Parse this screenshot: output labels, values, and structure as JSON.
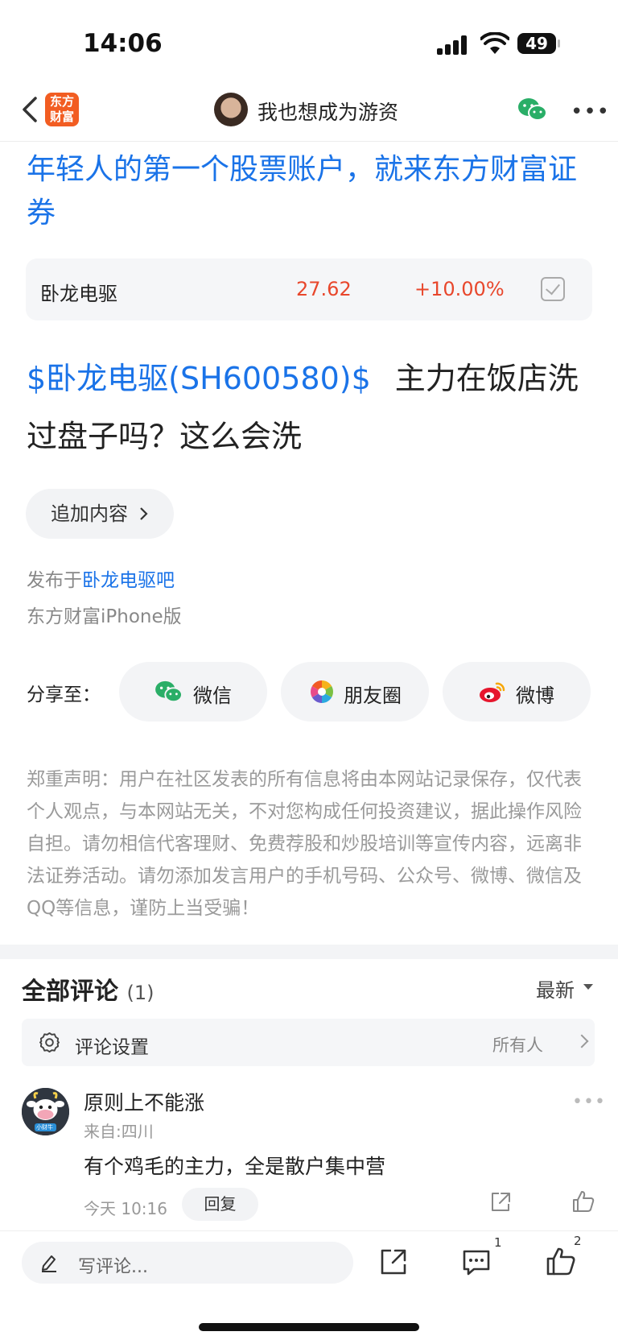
{
  "status_bar": {
    "time": "14:06",
    "battery": "49"
  },
  "header": {
    "logo_text": "东方财富",
    "username": "我也想成为游资"
  },
  "ad": {
    "text": "年轻人的第一个股票账户，就来东方财富证券"
  },
  "stock": {
    "name": "卧龙电驱",
    "price": "27.62",
    "change": "+10.00%"
  },
  "post": {
    "tag": "$卧龙电驱(SH600580)$",
    "text": "主力在饭店洗过盘子吗？这么会洗"
  },
  "append_label": "追加内容",
  "meta": {
    "published_prefix": "发布于",
    "bar_name": "卧龙电驱吧",
    "client": "东方财富iPhone版"
  },
  "share": {
    "label": "分享至：",
    "buttons": [
      "微信",
      "朋友圈",
      "微博"
    ]
  },
  "disclaimer": "郑重声明：用户在社区发表的所有信息将由本网站记录保存，仅代表个人观点，与本网站无关，不对您构成任何投资建议，据此操作风险自担。请勿相信代客理财、免费荐股和炒股培训等宣传内容，远离非法证券活动。请勿添加发言用户的手机号码、公众号、微博、微信及QQ等信息，谨防上当受骗！",
  "comments": {
    "title": "全部评论",
    "count": "(1)",
    "sort": "最新",
    "settings_label": "评论设置",
    "settings_value": "所有人",
    "items": [
      {
        "name": "原则上不能涨",
        "location": "来自:四川",
        "text": "有个鸡毛的主力，全是散户集中营",
        "time": "今天 10:16",
        "reply": "回复",
        "avatar_text": "小财牛"
      }
    ]
  },
  "bottom_bar": {
    "placeholder": "写评论...",
    "comment_count": "1",
    "like_count": "2"
  },
  "colors": {
    "link_blue": "#1a73e8",
    "up_red": "#e8472c",
    "brand_orange": "#f25d22",
    "wechat_green": "#2aae67"
  }
}
